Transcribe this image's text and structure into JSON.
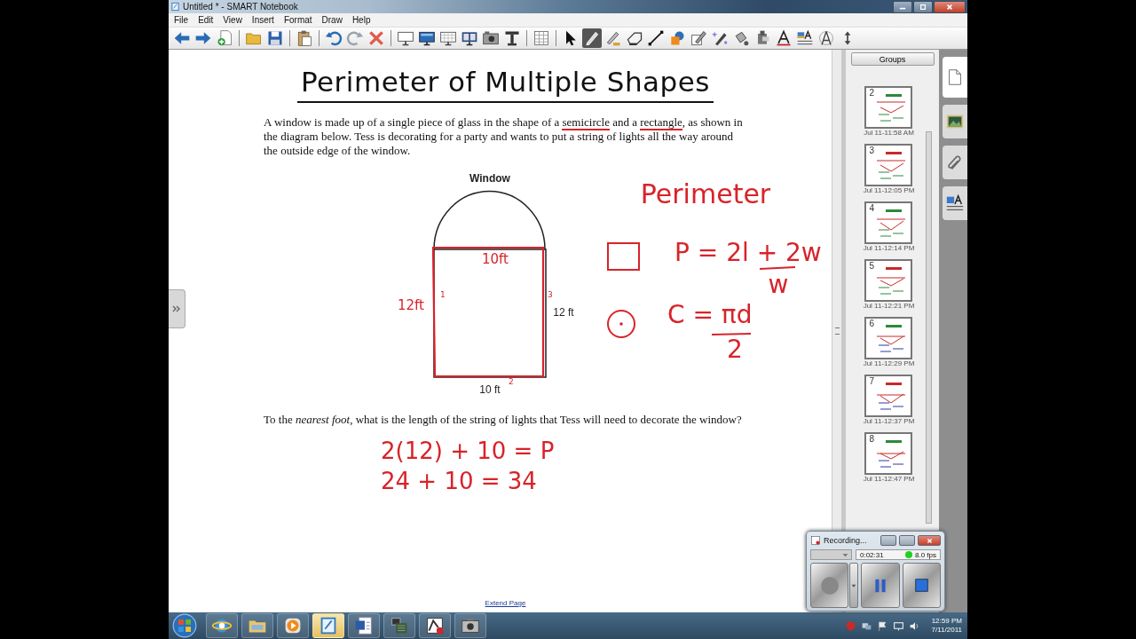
{
  "window": {
    "title": "Untitled * - SMART Notebook"
  },
  "menu": [
    "File",
    "Edit",
    "View",
    "Insert",
    "Format",
    "Draw",
    "Help"
  ],
  "toolbar": {
    "groups": [
      [
        {
          "kind": "back",
          "selected": false
        },
        {
          "kind": "forward",
          "selected": false
        },
        {
          "kind": "add-page",
          "selected": false
        }
      ],
      [
        {
          "kind": "open",
          "selected": false
        },
        {
          "kind": "save",
          "selected": false
        }
      ],
      [
        {
          "kind": "paste",
          "selected": false
        }
      ],
      [
        {
          "kind": "undo",
          "selected": false
        },
        {
          "kind": "redo",
          "selected": false
        },
        {
          "kind": "delete",
          "selected": false
        }
      ],
      [
        {
          "kind": "screen",
          "selected": false
        },
        {
          "kind": "monitor",
          "selected": false
        },
        {
          "kind": "transparent",
          "selected": false
        },
        {
          "kind": "dual",
          "selected": false
        },
        {
          "kind": "camera",
          "selected": false
        },
        {
          "kind": "stand",
          "selected": false
        }
      ],
      [
        {
          "kind": "table",
          "selected": false
        }
      ],
      [
        {
          "kind": "select",
          "selected": false
        },
        {
          "kind": "pen",
          "selected": true
        },
        {
          "kind": "creative-pen",
          "selected": false
        },
        {
          "kind": "eraser",
          "selected": false
        },
        {
          "kind": "line",
          "selected": false
        },
        {
          "kind": "shapes",
          "selected": false
        },
        {
          "kind": "pencil-box",
          "selected": false
        },
        {
          "kind": "sparkle-pen",
          "selected": false
        },
        {
          "kind": "fill",
          "selected": false
        },
        {
          "kind": "properties",
          "selected": false
        },
        {
          "kind": "text",
          "selected": false
        },
        {
          "kind": "text-style",
          "selected": false
        },
        {
          "kind": "compass",
          "selected": false
        },
        {
          "kind": "move",
          "selected": false
        }
      ]
    ]
  },
  "page": {
    "title": "Perimeter of Multiple Shapes",
    "problem": [
      {
        "text": "A window is made up of a single piece of glass in the shape of a ",
        "underlined": false
      },
      {
        "text": "semicircle",
        "underlined": true
      },
      {
        "text": " and a ",
        "underlined": false
      },
      {
        "text": "rectangle",
        "underlined": true
      },
      {
        "text": ", as shown in the diagram below.  Tess is decorating for a party and wants to put a string of lights all the way around the outside edge of the window.",
        "underlined": false
      }
    ],
    "diagram": {
      "title": "Window",
      "side_label": "12 ft",
      "bottom_label": "10 ft"
    },
    "notes": {
      "heading": "Perimeter",
      "rectangle_formula": "P = 2l + 2w",
      "rectangle_formula_below": "w",
      "circle_formula": "C = πd",
      "circle_formula_below": "2",
      "top_width": "10ft",
      "left_height": "12ft",
      "side_marks": [
        "1",
        "3",
        "2"
      ]
    },
    "question": "To the *nearest foot*, what is the length of the string of lights that Tess will need to decorate the window?",
    "work": [
      "2(12) + 10 = P",
      "24 + 10 = 34"
    ],
    "extend_link": "Extend Page"
  },
  "sidebar": {
    "groups_button": "Groups",
    "pages": [
      {
        "number": "2",
        "time": "Jul 11-11:58 AM"
      },
      {
        "number": "3",
        "time": "Jul 11-12:05 PM"
      },
      {
        "number": "4",
        "time": "Jul 11-12:14 PM"
      },
      {
        "number": "5",
        "time": "Jul 11-12:21 PM"
      },
      {
        "number": "6",
        "time": "Jul 11-12:29 PM"
      },
      {
        "number": "7",
        "time": "Jul 11-12:37 PM"
      },
      {
        "number": "8",
        "time": "Jul 11-12:47 PM"
      }
    ],
    "tabs": [
      {
        "kind": "page",
        "selected": true
      },
      {
        "kind": "gallery",
        "selected": false
      },
      {
        "kind": "attachments",
        "selected": false
      },
      {
        "kind": "properties",
        "selected": false
      }
    ]
  },
  "recorder": {
    "title": "Recording...",
    "source_dropdown": {
      "disabled": true
    },
    "elapsed": "0:02:31",
    "frame_rate": "8.0 fps"
  },
  "taskbar": {
    "apps": [
      {
        "kind": "browser",
        "selected": false
      },
      {
        "kind": "folder",
        "selected": false
      },
      {
        "kind": "media",
        "selected": false
      },
      {
        "kind": "notebook",
        "selected": true
      },
      {
        "kind": "word",
        "selected": false
      },
      {
        "kind": "screen-app",
        "selected": false
      },
      {
        "kind": "recorder",
        "selected": false
      },
      {
        "kind": "camera",
        "selected": false
      }
    ],
    "time": "12:59 PM",
    "date": "7/11/2011"
  }
}
